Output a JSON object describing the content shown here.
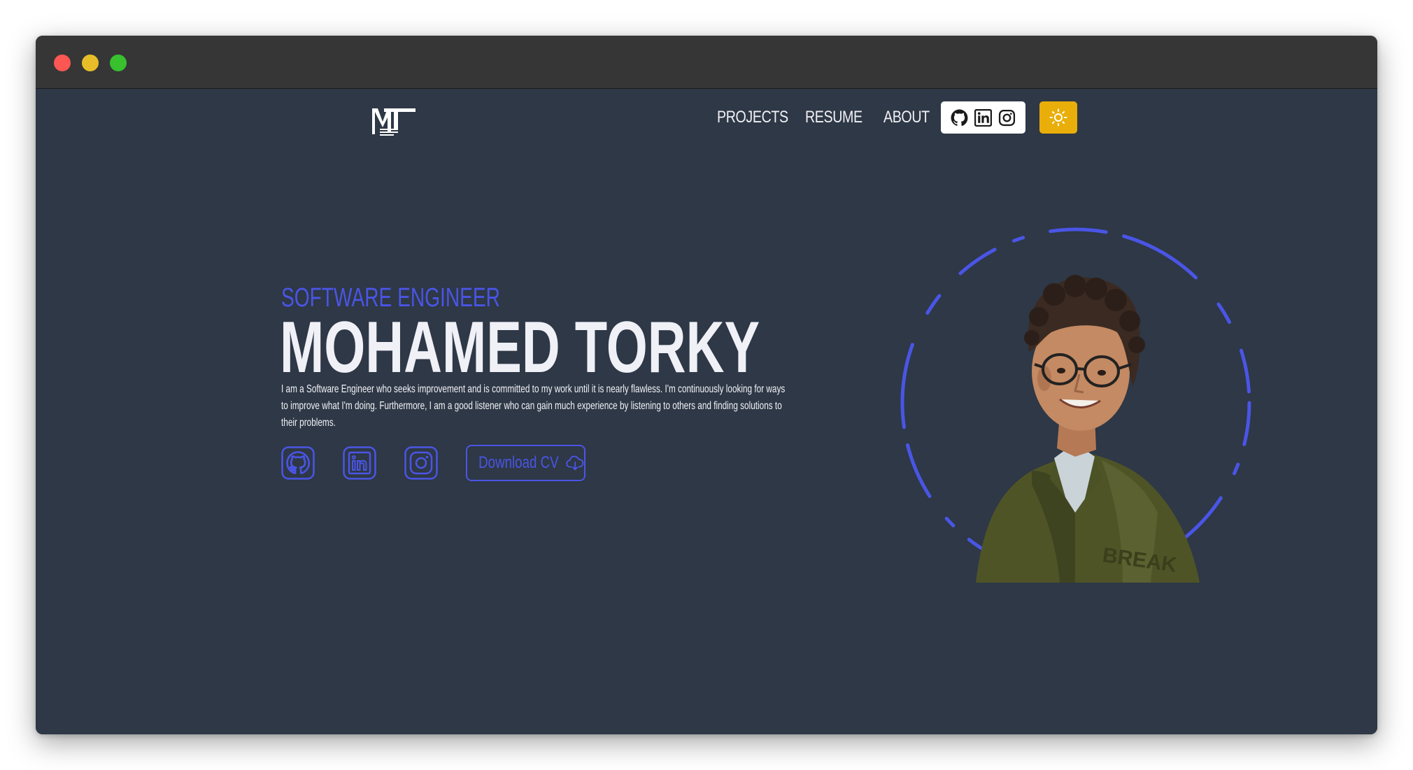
{
  "window": {
    "controls": [
      "close",
      "minimize",
      "maximize"
    ]
  },
  "navbar": {
    "logo_text": "MT",
    "logo_subtext": "MOHAMED TORKY",
    "links": [
      {
        "label": "PROJECTS"
      },
      {
        "label": "RESUME"
      },
      {
        "label": "ABOUT"
      }
    ],
    "social_icons": [
      "github-icon",
      "linkedin-icon",
      "instagram-icon"
    ],
    "theme_toggle_icon": "sun-icon",
    "theme_toggle_color": "#eaae0a"
  },
  "hero": {
    "subtitle": "SOFTWARE ENGINEER",
    "name": "MOHAMED TORKY",
    "bio": "I am a Software Engineer who seeks improvement and is committed to my work until it is nearly flawless. I'm continuously looking for ways to improve what I'm doing. Furthermore, I am a good listener who can gain much experience by listening to others and finding solutions to their problems.",
    "social_icons": [
      "github-icon",
      "linkedin-icon",
      "instagram-icon"
    ],
    "download_label": "Download CV",
    "download_icon": "cloud-download-icon"
  },
  "colors": {
    "background": "#2e3846",
    "accent": "#4a55e6",
    "text": "#f0f0f7",
    "theme_button": "#eaae0a"
  }
}
